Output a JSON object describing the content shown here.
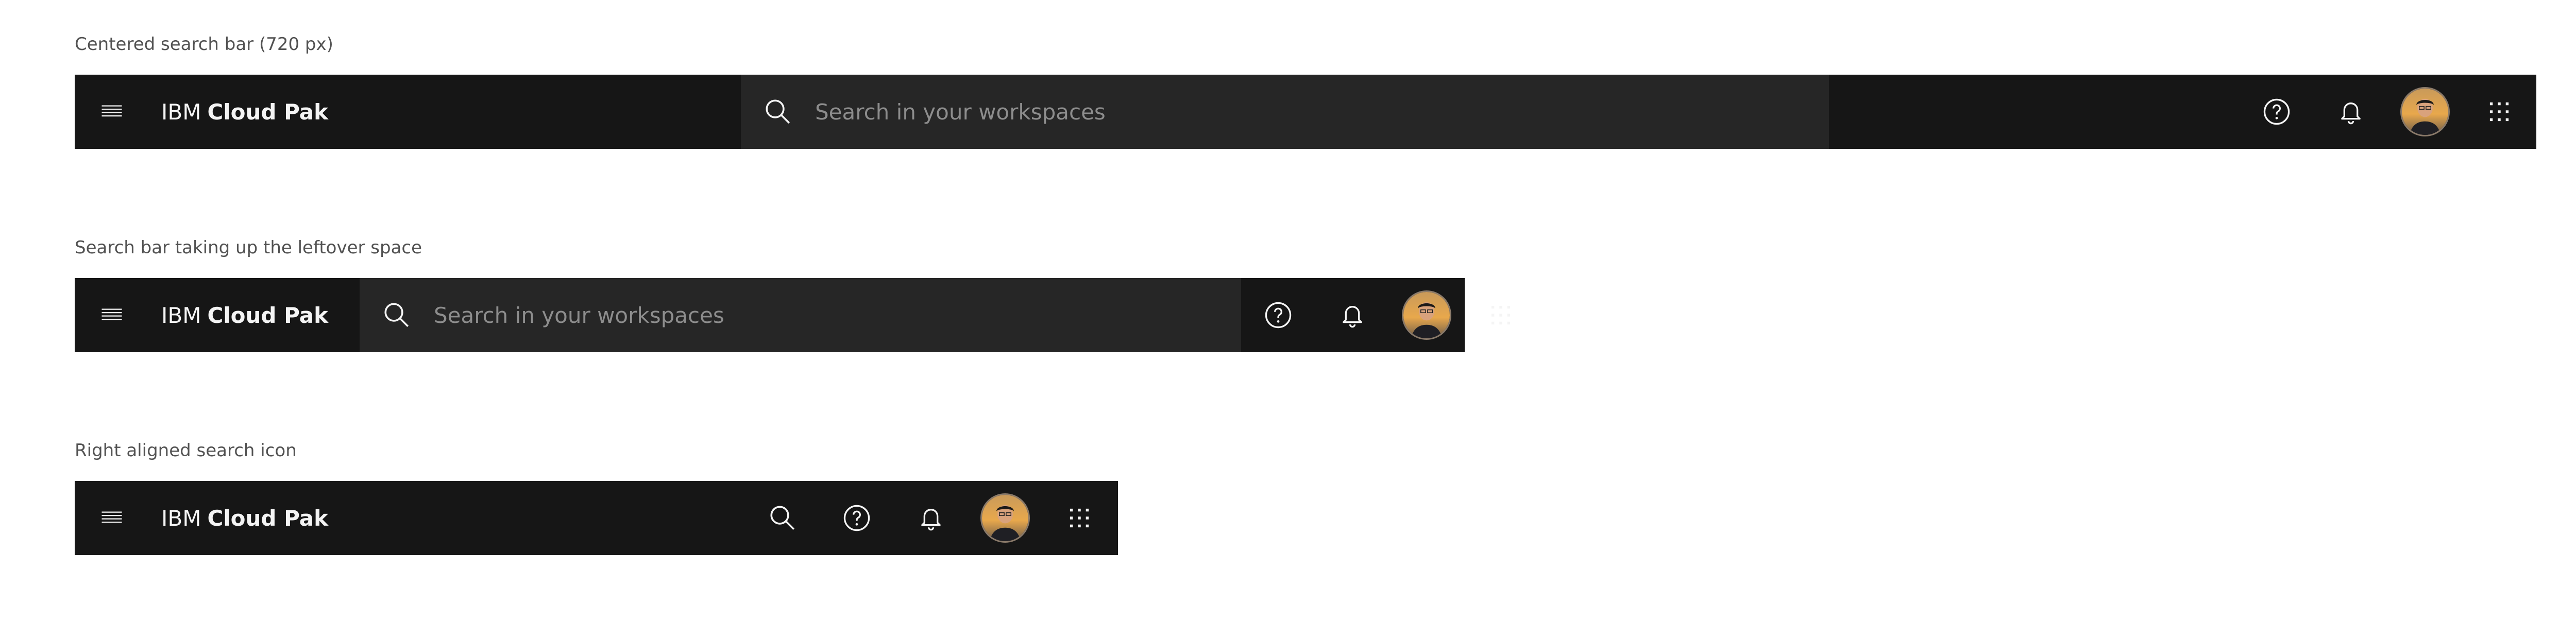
{
  "sections": [
    {
      "label": "Centered search bar (720 px)"
    },
    {
      "label": "Search bar taking up the leftover space"
    },
    {
      "label": "Right aligned search icon"
    }
  ],
  "header": {
    "brand_prefix": "IBM",
    "brand_product": "Cloud Pak",
    "search_placeholder": "Search in your workspaces"
  },
  "icons": {
    "menu": "menu-icon",
    "search": "search-icon",
    "help": "help-icon",
    "notification": "notification-icon",
    "avatar": "user-avatar",
    "switcher": "app-switcher-icon"
  },
  "colors": {
    "shell_background": "#161616",
    "search_background": "#262626",
    "text": "#f4f4f4",
    "placeholder": "#8d8d8d",
    "label": "#525252"
  }
}
